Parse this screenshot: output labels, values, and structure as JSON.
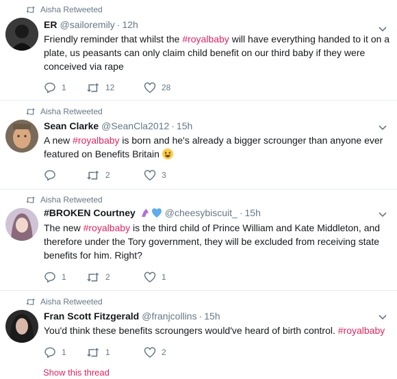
{
  "tweets": [
    {
      "retweeted_by": "Aisha Retweeted",
      "name": "ER",
      "handle": "@sailoremily",
      "time": "12h",
      "text_parts": [
        {
          "t": "Friendly reminder that whilst the "
        },
        {
          "t": "#royalbaby",
          "tag": true
        },
        {
          "t": " will have everything handed to it on a plate, us peasants can only claim child benefit on our third baby if they were conceived via rape"
        }
      ],
      "replies": "1",
      "retweets": "12",
      "likes": "28"
    },
    {
      "retweeted_by": "Aisha Retweeted",
      "name": "Sean Clarke",
      "handle": "@SeanCla2012",
      "time": "15h",
      "text_parts": [
        {
          "t": "A new "
        },
        {
          "t": "#royalbaby",
          "tag": true
        },
        {
          "t": " is born and he's already a bigger scrounger than anyone ever featured on Benefits Britain "
        }
      ],
      "replies": "",
      "retweets": "2",
      "likes": "3",
      "emoji": "grinning-squinting-face"
    },
    {
      "retweeted_by": "Aisha Retweeted",
      "name": "#BROKEN Courtney",
      "name_emoji": [
        "unicorn-icon",
        "blue-heart-icon"
      ],
      "handle": "@cheesybiscuit_",
      "time": "15h",
      "text_parts": [
        {
          "t": "The new "
        },
        {
          "t": "#royalbaby",
          "tag": true
        },
        {
          "t": " is the third child of Prince William and Kate Middleton, and therefore under the Tory government, they will be excluded from receiving state benefits for him. Right?"
        }
      ],
      "replies": "1",
      "retweets": "2",
      "likes": "1"
    },
    {
      "retweeted_by": "Aisha Retweeted",
      "name": "Fran Scott Fitzgerald",
      "handle": "@franjcollins",
      "time": "15h",
      "text_parts": [
        {
          "t": "You'd think these benefits scroungers would've heard of birth control. "
        },
        {
          "t": "#royalbaby",
          "tag": true
        }
      ],
      "replies": "1",
      "retweets": "1",
      "likes": "2"
    }
  ],
  "show_thread": "Show this thread",
  "colors": {
    "accent": "#e0245e",
    "muted": "#657786",
    "divider": "#e6ecf0"
  }
}
